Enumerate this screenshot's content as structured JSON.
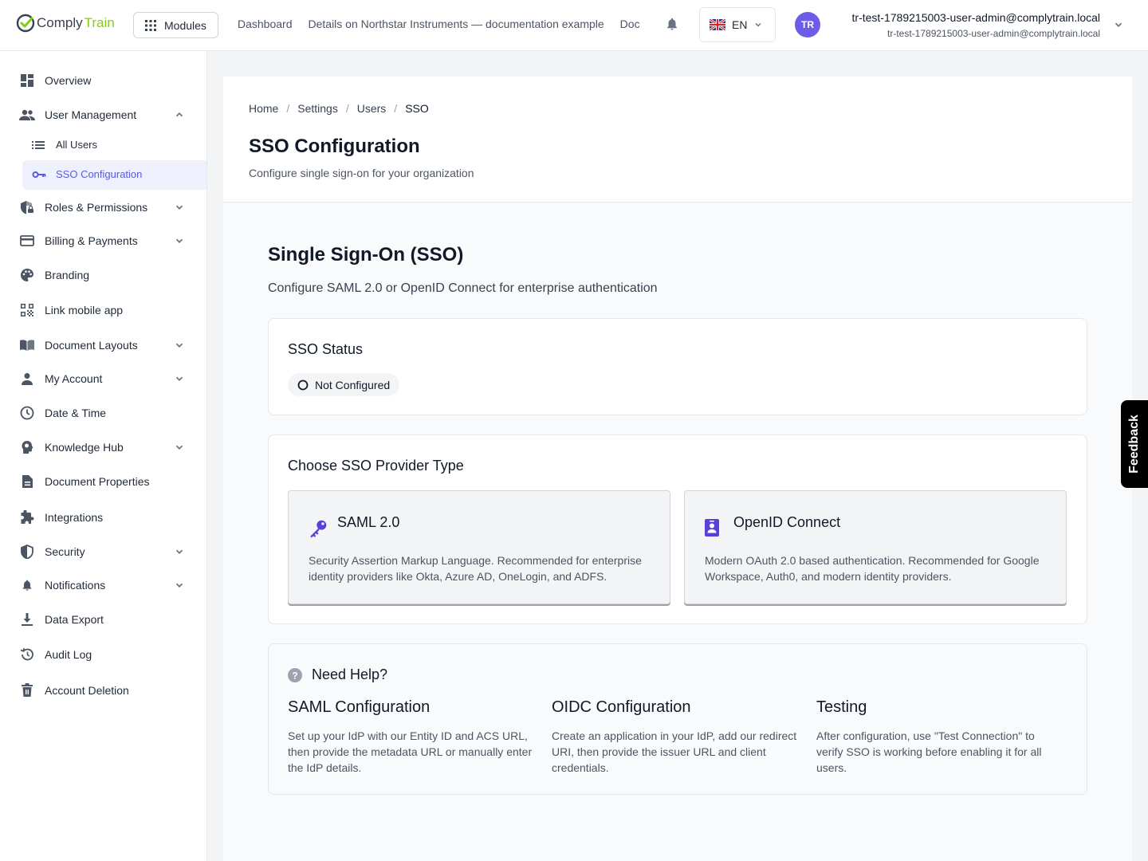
{
  "app": {
    "logo_part1": "Comply",
    "logo_part2": "Train",
    "modules_label": "Modules",
    "topnav": [
      "Dashboard",
      "Details on Northstar Instruments — documentation example",
      "Doc"
    ],
    "language": "EN",
    "avatar_initials": "TR",
    "user_name": "tr-test-1789215003-user-admin@complytrain.local",
    "user_email": "tr-test-1789215003-user-admin@complytrain.local"
  },
  "sidebar": {
    "items": [
      {
        "label": "Overview"
      },
      {
        "label": "User Management"
      },
      {
        "label": "All Users"
      },
      {
        "label": "SSO Configuration"
      },
      {
        "label": "Roles & Permissions"
      },
      {
        "label": "Billing & Payments"
      },
      {
        "label": "Branding"
      },
      {
        "label": "Link mobile app"
      },
      {
        "label": "Document Layouts"
      },
      {
        "label": "My Account"
      },
      {
        "label": "Date & Time"
      },
      {
        "label": "Knowledge Hub"
      },
      {
        "label": "Document Properties"
      },
      {
        "label": "Integrations"
      },
      {
        "label": "Security"
      },
      {
        "label": "Notifications"
      },
      {
        "label": "Data Export"
      },
      {
        "label": "Audit Log"
      },
      {
        "label": "Account Deletion"
      }
    ]
  },
  "header": {
    "breadcrumb": [
      "Home",
      "Settings",
      "Users",
      "SSO"
    ],
    "title": "SSO Configuration",
    "subtitle": "Configure single sign-on for your organization"
  },
  "sso": {
    "title": "Single Sign-On (SSO)",
    "subtitle": "Configure SAML 2.0 or OpenID Connect for enterprise authentication",
    "status_title": "SSO Status",
    "status_value": "Not Configured",
    "provider_title": "Choose SSO Provider Type",
    "options": [
      {
        "title": "SAML 2.0",
        "desc": "Security Assertion Markup Language. Recommended for enterprise identity providers like Okta, Azure AD, OneLogin, and ADFS."
      },
      {
        "title": "OpenID Connect",
        "desc": "Modern OAuth 2.0 based authentication. Recommended for Google Workspace, Auth0, and modern identity providers."
      }
    ]
  },
  "help": {
    "title": "Need Help?",
    "columns": [
      {
        "title": "SAML Configuration",
        "text": "Set up your IdP with our Entity ID and ACS URL, then provide the metadata URL or manually enter the IdP details."
      },
      {
        "title": "OIDC Configuration",
        "text": "Create an application in your IdP, add our redirect URI, then provide the issuer URL and client credentials."
      },
      {
        "title": "Testing",
        "text": "After configuration, use \"Test Connection\" to verify SSO is working before enabling it for all users."
      }
    ]
  },
  "feedback_label": "Feedback",
  "colors": {
    "accent": "#5b5bd6",
    "active_bg": "#eef0fd",
    "logo_green": "#84cc16"
  }
}
